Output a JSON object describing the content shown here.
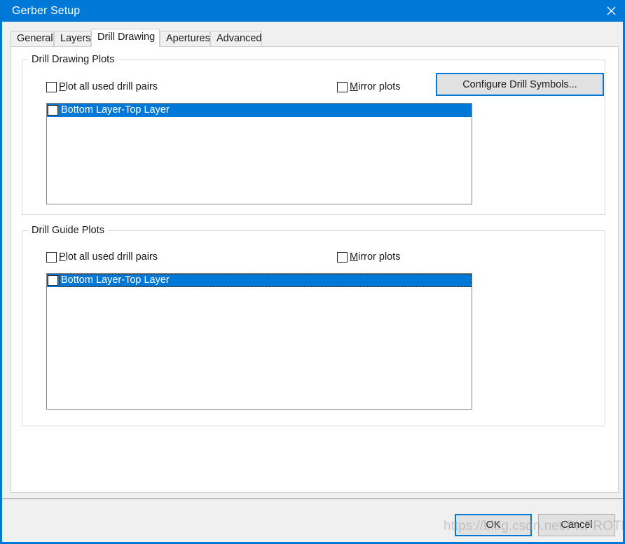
{
  "window": {
    "title": "Gerber Setup",
    "close_icon": "close-icon",
    "accent_color": "#0078d7",
    "panel_color": "#f0f0f0",
    "content_color": "#ffffff"
  },
  "tabs": [
    {
      "label": "General",
      "active": false
    },
    {
      "label": "Layers",
      "active": false
    },
    {
      "label": "Drill Drawing",
      "active": true
    },
    {
      "label": "Apertures",
      "active": false
    },
    {
      "label": "Advanced",
      "active": false
    }
  ],
  "drill_drawing_plots": {
    "title": "Drill Drawing Plots",
    "plot_all_pre": "",
    "plot_all_accel": "P",
    "plot_all_post": "lot all used drill pairs",
    "plot_all_checked": false,
    "mirror_pre": "",
    "mirror_accel": "M",
    "mirror_post": "irror plots",
    "mirror_checked": false,
    "configure_button": "Configure Drill Symbols...",
    "list_items": [
      {
        "label": "Bottom Layer-Top Layer",
        "checked": false,
        "selected": true,
        "focused": false
      }
    ]
  },
  "drill_guide_plots": {
    "title": "Drill Guide Plots",
    "plot_all_pre": "",
    "plot_all_accel": "P",
    "plot_all_post": "lot all used drill pairs",
    "plot_all_checked": false,
    "mirror_pre": "",
    "mirror_accel": "M",
    "mirror_post": "irror plots",
    "mirror_checked": false,
    "list_items": [
      {
        "label": "Bottom Layer-Top Layer",
        "checked": false,
        "selected": true,
        "focused": true
      }
    ]
  },
  "footer": {
    "ok_label": "OK",
    "cancel_label": "Cancel"
  },
  "watermark": {
    "text": "https://blog.csdn.net/PKPROTEUS"
  }
}
